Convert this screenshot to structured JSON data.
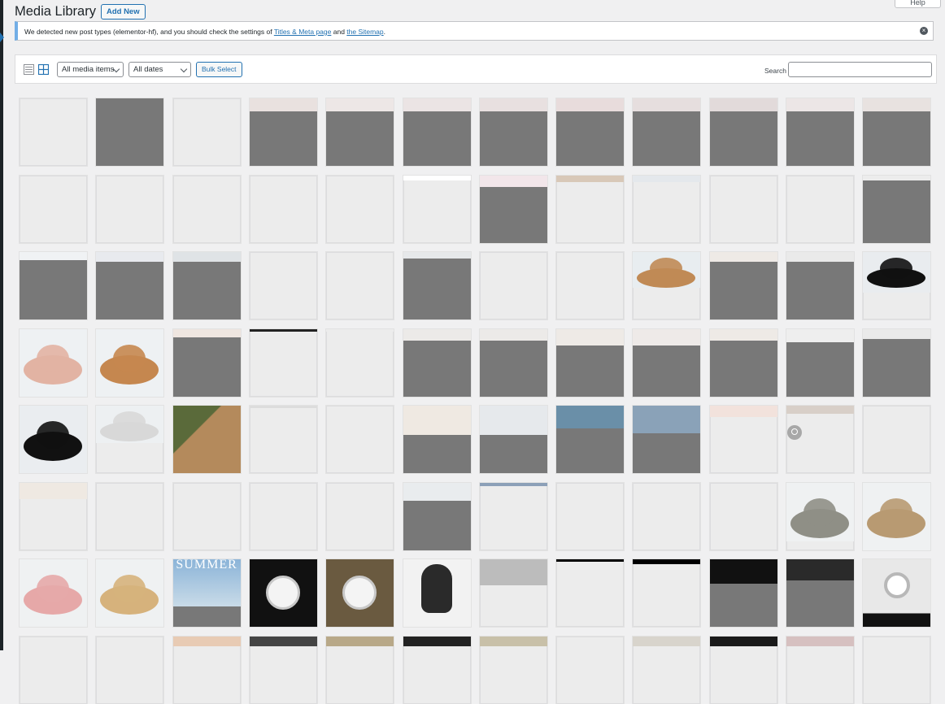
{
  "header": {
    "title": "Media Library",
    "add_new": "Add New",
    "help": "Help"
  },
  "notice": {
    "text_before": "We detected new post types (elementor-hf), and you should check the settings of ",
    "link1": "Titles & Meta page",
    "text_mid": " and ",
    "link2": "the Sitemap",
    "text_after": "."
  },
  "toolbar": {
    "list_view_icon": "list-view-icon",
    "grid_view_icon": "grid-view-icon",
    "filter_type": "All media items",
    "filter_date": "All dates",
    "bulk_select": "Bulk Select",
    "search_label": "Search",
    "search_value": ""
  },
  "colors": {
    "accent": "#2271b1",
    "notice_border": "#72aee6",
    "placeholder_gray": "#787878",
    "tile_bg": "#ececec"
  },
  "grid": {
    "columns": 12,
    "tiles": [
      {
        "t": "blank"
      },
      {
        "t": "gray",
        "cut": 0
      },
      {
        "t": "blank"
      },
      {
        "t": "gray",
        "cut": 16,
        "top": "#e9e1df"
      },
      {
        "t": "gray",
        "cut": 16,
        "top": "#ede7e6"
      },
      {
        "t": "gray",
        "cut": 16,
        "top": "#ebe4e4"
      },
      {
        "t": "gray",
        "cut": 16,
        "top": "#e8e0e0"
      },
      {
        "t": "gray",
        "cut": 16,
        "top": "#e8dcdc"
      },
      {
        "t": "gray",
        "cut": 16,
        "top": "#e6dede"
      },
      {
        "t": "gray",
        "cut": 16,
        "top": "#e2dada"
      },
      {
        "t": "gray",
        "cut": 16,
        "top": "#ece6e6"
      },
      {
        "t": "gray",
        "cut": 16,
        "top": "#e8e2e0"
      },
      {
        "t": "blank"
      },
      {
        "t": "blank"
      },
      {
        "t": "blank"
      },
      {
        "t": "blank"
      },
      {
        "t": "blank"
      },
      {
        "t": "img",
        "top": "#ffffff",
        "h": 6
      },
      {
        "t": "gray",
        "cut": 14,
        "top": "#f2e6ea"
      },
      {
        "t": "img",
        "top": "#d8c8b8",
        "h": 8
      },
      {
        "t": "img",
        "top": "#e4e8ec",
        "h": 8
      },
      {
        "t": "blank"
      },
      {
        "t": "blank"
      },
      {
        "t": "gray",
        "cut": 6,
        "top": "#ececec"
      },
      {
        "t": "gray",
        "cut": 10,
        "top": "#f0f2f4"
      },
      {
        "t": "gray",
        "cut": 12,
        "top": "#e8eaee"
      },
      {
        "t": "gray",
        "cut": 12,
        "top": "#dfe3e6"
      },
      {
        "t": "blank"
      },
      {
        "t": "blank"
      },
      {
        "t": "gray",
        "cut": 8,
        "top": "#e6e8ea"
      },
      {
        "t": "blank"
      },
      {
        "t": "blank"
      },
      {
        "t": "hat",
        "hat": "#c08a55",
        "bg": "#e8edf0",
        "cut": 44
      },
      {
        "t": "gray",
        "cut": 12,
        "top": "#eeeae6"
      },
      {
        "t": "gray",
        "cut": 12,
        "top": "#eaeaea"
      },
      {
        "t": "hat",
        "hat": "#111111",
        "bg": "#e9ecef",
        "cut": 50
      },
      {
        "t": "hat",
        "hat": "#e2b3a3",
        "bg": "#eef1f3",
        "cut": 83
      },
      {
        "t": "hat",
        "hat": "#c5874f",
        "bg": "#eef1f3",
        "cut": 83
      },
      {
        "t": "gray",
        "cut": 10,
        "top": "#efe6e0"
      },
      {
        "t": "img",
        "top": "#222222",
        "h": 3
      },
      {
        "t": "img",
        "top": "#ececec",
        "h": 3
      },
      {
        "t": "gray",
        "cut": 14,
        "top": "#eceae8"
      },
      {
        "t": "gray",
        "cut": 14,
        "top": "#eceae8"
      },
      {
        "t": "gray",
        "cut": 20,
        "top": "#eeeae6"
      },
      {
        "t": "gray",
        "cut": 20,
        "top": "#eeeae8"
      },
      {
        "t": "gray",
        "cut": 14,
        "top": "#eeeae6"
      },
      {
        "t": "gray",
        "cut": 16,
        "top": "#eeeeee"
      },
      {
        "t": "gray",
        "cut": 12,
        "top": "#eaeaea"
      },
      {
        "t": "hat",
        "hat": "#111111",
        "bg": "#eaedf0",
        "cut": 83
      },
      {
        "t": "hat",
        "hat": "#d8d8d8",
        "bg": "#edf0f2",
        "cut": 46
      },
      {
        "t": "photo",
        "c1": "#5a6a3a",
        "c2": "#b48a5c",
        "cut": 83
      },
      {
        "t": "img",
        "top": "#dcdcdc",
        "h": 3
      },
      {
        "t": "blank"
      },
      {
        "t": "gray",
        "cut": 36,
        "top": "#efe9e2"
      },
      {
        "t": "gray",
        "cut": 36,
        "top": "#e6e9ec"
      },
      {
        "t": "gray",
        "cut": 28,
        "top": "#6a8fa8"
      },
      {
        "t": "gray",
        "cut": 34,
        "top": "#8aa2b8"
      },
      {
        "t": "img",
        "top": "#f2e2dc",
        "h": 14
      },
      {
        "t": "zoom",
        "top": "#d8cfc8",
        "h": 10
      },
      {
        "t": "blank"
      },
      {
        "t": "img",
        "top": "#efe9e2",
        "h": 20
      },
      {
        "t": "blank"
      },
      {
        "t": "blank"
      },
      {
        "t": "blank"
      },
      {
        "t": "blank"
      },
      {
        "t": "gray",
        "cut": 22,
        "top": "#e9ecee"
      },
      {
        "t": "img",
        "top": "#8ca0b8",
        "h": 4
      },
      {
        "t": "blank"
      },
      {
        "t": "blank"
      },
      {
        "t": "blank"
      },
      {
        "t": "hat",
        "hat": "#8f8f86",
        "bg": "#eff1f2",
        "cut": 72
      },
      {
        "t": "hat",
        "hat": "#b89a72",
        "bg": "#eff1f2",
        "cut": 83
      },
      {
        "t": "hat",
        "hat": "#e6a8a8",
        "bg": "#eff1f2",
        "cut": 83
      },
      {
        "t": "hat",
        "hat": "#d6b27c",
        "bg": "#eff1f2",
        "cut": 83
      },
      {
        "t": "summer",
        "cut": 58
      },
      {
        "t": "watch",
        "bg": "#111111",
        "cut": 83
      },
      {
        "t": "watch",
        "bg": "#6a5a40",
        "cut": 83
      },
      {
        "t": "portrait",
        "cut": 83
      },
      {
        "t": "img",
        "top": "#bcbcbc",
        "h": 32
      },
      {
        "t": "img",
        "top": "#000000",
        "h": 3
      },
      {
        "t": "img",
        "top": "#000000",
        "h": 6
      },
      {
        "t": "gray",
        "cut": 30,
        "top": "#111111"
      },
      {
        "t": "gray",
        "cut": 26,
        "top": "#2a2a2a"
      },
      {
        "t": "watch2",
        "cut": 83
      },
      {
        "t": "blank"
      },
      {
        "t": "blank"
      },
      {
        "t": "img",
        "top": "#e8cbb4",
        "h": 12
      },
      {
        "t": "img",
        "top": "#444444",
        "h": 12
      },
      {
        "t": "img",
        "top": "#b8a888",
        "h": 12
      },
      {
        "t": "img",
        "top": "#222222",
        "h": 12
      },
      {
        "t": "img",
        "top": "#c8c0a8",
        "h": 12
      },
      {
        "t": "blank"
      },
      {
        "t": "img",
        "top": "#d8d4cc",
        "h": 12
      },
      {
        "t": "img",
        "top": "#1a1a1a",
        "h": 12
      },
      {
        "t": "img",
        "top": "#d6c0c0",
        "h": 12
      },
      {
        "t": "blank"
      }
    ]
  }
}
